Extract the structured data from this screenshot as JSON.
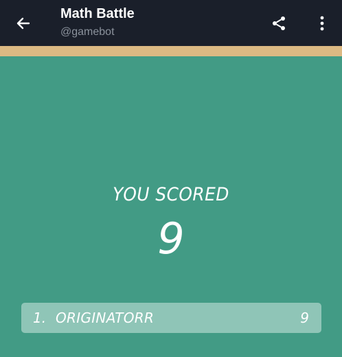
{
  "header": {
    "title": "Math Battle",
    "subtitle": "@gamebot",
    "back_icon": "arrow-left-icon",
    "share_icon": "share-icon",
    "more_icon": "more-vertical-icon"
  },
  "colors": {
    "header_bg": "#1a1f2a",
    "accent_strip": "#dcb983",
    "game_bg": "#429b85",
    "leaderboard_row_bg": "#8fc5b7",
    "text": "#ffffff"
  },
  "score": {
    "label": "YOU SCORED",
    "value": "9"
  },
  "leaderboard": [
    {
      "rank": "1.",
      "name": "ORIGINATORR",
      "score": "9"
    }
  ]
}
